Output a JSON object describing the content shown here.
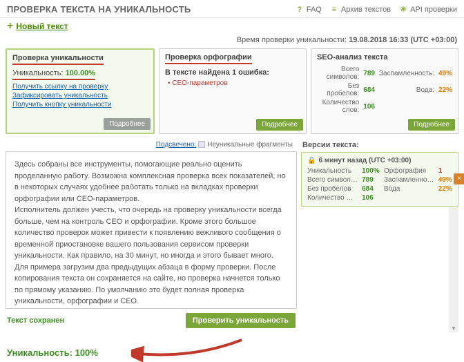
{
  "header": {
    "title": "ПРОВЕРКА ТЕКСТА НА УНИКАЛЬНОСТЬ",
    "links": {
      "faq": "FAQ",
      "archive": "Архив текстов",
      "api": "API проверки"
    }
  },
  "newtext": "Новый текст",
  "timebar": {
    "label": "Время проверки уникальности:",
    "value": "19.08.2018 16:33 (UTC +03:00)"
  },
  "uniq": {
    "title": "Проверка уникальности",
    "line_label": "Уникальность:",
    "line_value": "100.00%",
    "link1": "Получить ссылку на проверку",
    "link2": "Зафиксировать уникальность",
    "link3": "Получить кнопку уникальности",
    "btn": "Подробнее"
  },
  "spell": {
    "title": "Проверка орфографии",
    "err": "В тексте найдена 1 ошибка:",
    "bullet": "СЕО-параметров",
    "btn": "Подробнее"
  },
  "seo": {
    "title": "SEO-анализ текста",
    "rows": {
      "r1l": "Всего символов:",
      "r1v": "789",
      "r1l2": "Заспамленность:",
      "r1v2": "49%",
      "r2l": "Без пробелов:",
      "r2v": "684",
      "r2l2": "Вода:",
      "r2v2": "22%",
      "r3l": "Количество слов:",
      "r3v": "106"
    },
    "btn": "Подробнее"
  },
  "legend": {
    "pre": "Подсвечено:",
    "label": "Неуникальные фрагменты"
  },
  "body_text": "Здесь собраны все инструменты, помогающие реально оценить проделанную работу. Возможна комплексная проверка всех показателей, но в некоторых случаях удобнее работать только на вкладках проверки орфографии или СЕО-параметров.\nИсполнитель должен учесть, что очередь на проверку уникальности всегда больше, чем на контроль СЕО и орфографии. Кроме этого большое количество проверок может привести к появлению вежливого сообщения о временной приостановке вашего пользования сервисом проверки уникальности. Как правило, на 30 минут, но иногда и этого бывает много.\nДля примера загрузим два предыдущих абзаца в форму проверки. После копирования текста он сохраняется на сайте, но проверка начнется только по прямому указанию. По умолчанию это будет полная проверка уникальности, орфографии и СЕО.",
  "saved": "Текст сохранен",
  "checkbtn": "Проверить уникальность",
  "versions": {
    "title": "Версии текста:",
    "time": "6 минут назад  (UTC +03:00)",
    "g": {
      "a1": "Уникальность",
      "a2": "100%",
      "a3": "Орфография",
      "a4": "1",
      "b1": "Всего символ…",
      "b2": "789",
      "b3": "Заспамленно…",
      "b4": "49%",
      "c1": "Без пробелов",
      "c2": "684",
      "c3": "Вода",
      "c4": "22%",
      "d1": "Количество …",
      "d2": "106"
    }
  },
  "footer": {
    "label": "Уникальность:",
    "value": "100%"
  }
}
